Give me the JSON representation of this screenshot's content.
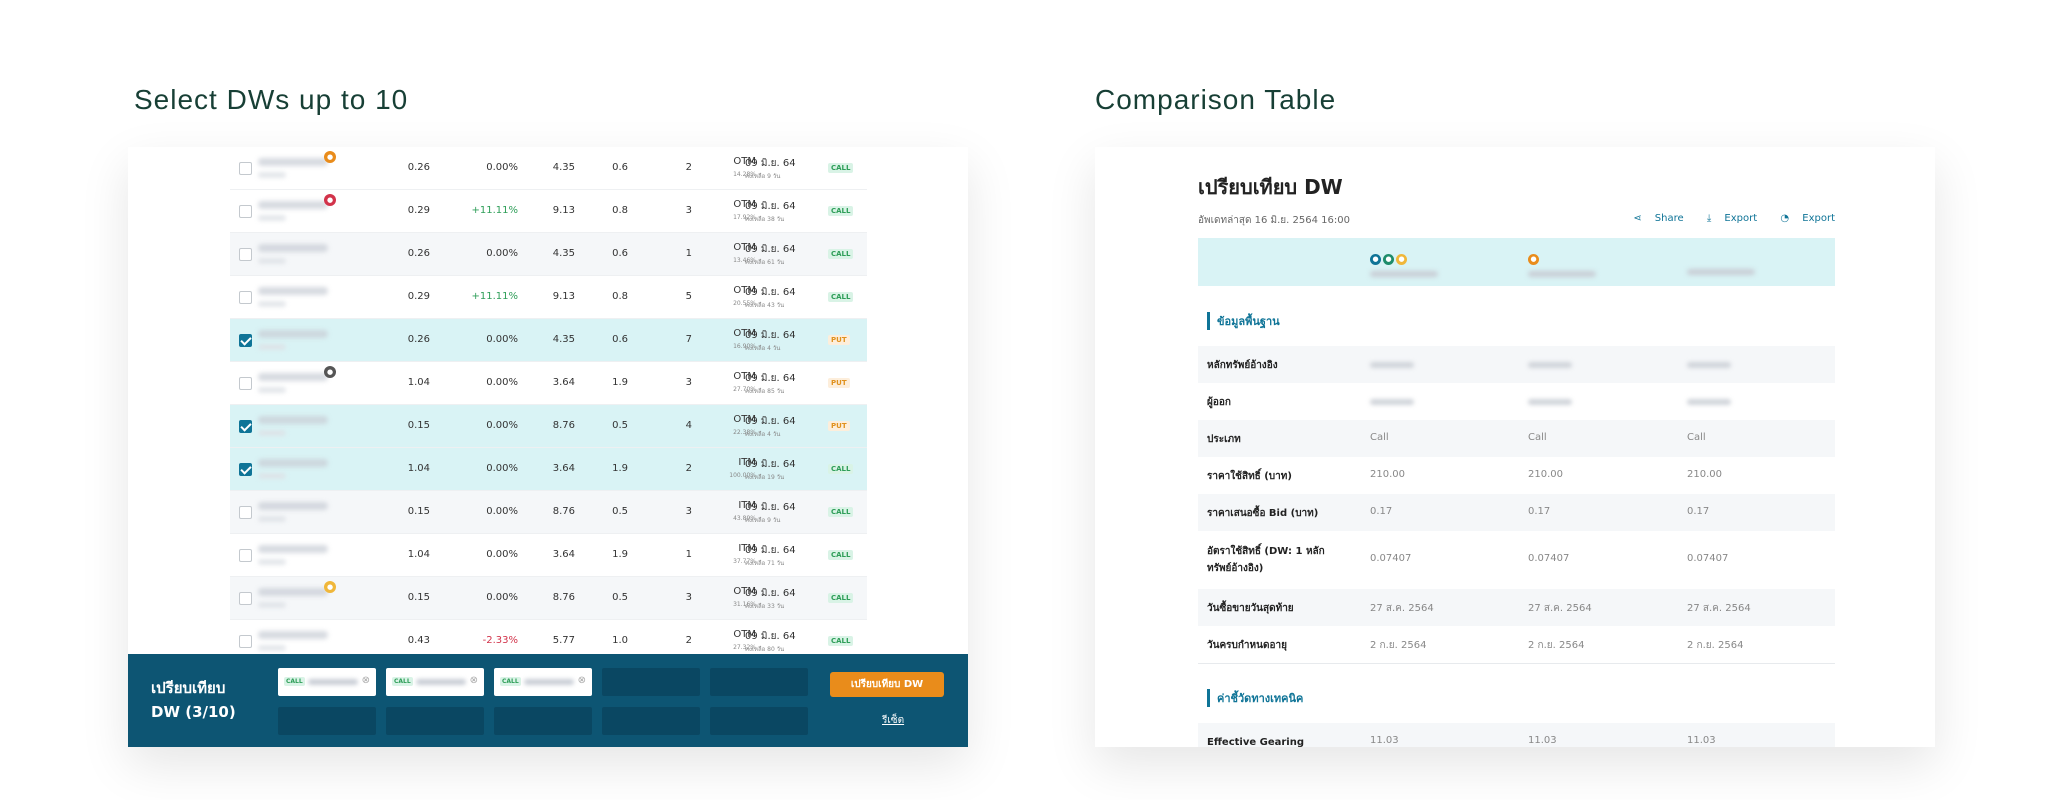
{
  "left_title": "Select DWs up to 10",
  "right_title": "Comparison Table",
  "colors": {
    "accent": "#0f7497",
    "bar": "#0d5573",
    "orange": "#e98c1b",
    "highlight": "#d9f3f5",
    "green": "#2e9e58",
    "red": "#d2334a"
  },
  "rows": [
    {
      "checked": false,
      "bg": "plain",
      "icon": "orange",
      "bid": "0.26",
      "change": "0.00%",
      "trend": "flat",
      "last": "4.35",
      "gearing": "0.6",
      "volume": "2",
      "status": "OTM",
      "pct": "14.28%",
      "date": "09 มิ.ย. 64",
      "days": "คงเหลือ 9 วัน",
      "type": "CALL"
    },
    {
      "checked": false,
      "bg": "plain",
      "icon": "pink",
      "bid": "0.29",
      "change": "+11.11%",
      "trend": "pos",
      "last": "9.13",
      "gearing": "0.8",
      "volume": "3",
      "status": "OTM",
      "pct": "17.92%",
      "date": "09 มิ.ย. 64",
      "days": "คงเหลือ 38 วัน",
      "type": "CALL"
    },
    {
      "checked": false,
      "bg": "alt",
      "icon": "",
      "bid": "0.26",
      "change": "0.00%",
      "trend": "flat",
      "last": "4.35",
      "gearing": "0.6",
      "volume": "1",
      "status": "OTM",
      "pct": "13.46%",
      "date": "09 มิ.ย. 64",
      "days": "คงเหลือ 61 วัน",
      "type": "CALL"
    },
    {
      "checked": false,
      "bg": "plain",
      "icon": "",
      "bid": "0.29",
      "change": "+11.11%",
      "trend": "pos",
      "last": "9.13",
      "gearing": "0.8",
      "volume": "5",
      "status": "OTM",
      "pct": "20.55%",
      "date": "09 มิ.ย. 64",
      "days": "คงเหลือ 43 วัน",
      "type": "CALL"
    },
    {
      "checked": true,
      "bg": "sel",
      "icon": "",
      "bid": "0.26",
      "change": "0.00%",
      "trend": "flat",
      "last": "4.35",
      "gearing": "0.6",
      "volume": "7",
      "status": "OTM",
      "pct": "16.90%",
      "date": "09 มิ.ย. 64",
      "days": "คงเหลือ 4 วัน",
      "type": "PUT"
    },
    {
      "checked": false,
      "bg": "plain",
      "icon": "grey",
      "bid": "1.04",
      "change": "0.00%",
      "trend": "flat",
      "last": "3.64",
      "gearing": "1.9",
      "volume": "3",
      "status": "OTM",
      "pct": "27.70%",
      "date": "09 มิ.ย. 64",
      "days": "คงเหลือ 85 วัน",
      "type": "PUT"
    },
    {
      "checked": true,
      "bg": "sel",
      "icon": "",
      "bid": "0.15",
      "change": "0.00%",
      "trend": "flat",
      "last": "8.76",
      "gearing": "0.5",
      "volume": "4",
      "status": "OTM",
      "pct": "22.38%",
      "date": "09 มิ.ย. 64",
      "days": "คงเหลือ 4 วัน",
      "type": "PUT"
    },
    {
      "checked": true,
      "bg": "sel",
      "icon": "",
      "bid": "1.04",
      "change": "0.00%",
      "trend": "flat",
      "last": "3.64",
      "gearing": "1.9",
      "volume": "2",
      "status": "ITM",
      "pct": "100.00%",
      "date": "09 มิ.ย. 64",
      "days": "คงเหลือ 19 วัน",
      "type": "CALL"
    },
    {
      "checked": false,
      "bg": "alt",
      "icon": "",
      "bid": "0.15",
      "change": "0.00%",
      "trend": "flat",
      "last": "8.76",
      "gearing": "0.5",
      "volume": "3",
      "status": "ITM",
      "pct": "43.89%",
      "date": "09 มิ.ย. 64",
      "days": "คงเหลือ 9 วัน",
      "type": "CALL"
    },
    {
      "checked": false,
      "bg": "plain",
      "icon": "",
      "bid": "1.04",
      "change": "0.00%",
      "trend": "flat",
      "last": "3.64",
      "gearing": "1.9",
      "volume": "1",
      "status": "ITM",
      "pct": "37.77%",
      "date": "09 มิ.ย. 64",
      "days": "คงเหลือ 71 วัน",
      "type": "CALL"
    },
    {
      "checked": false,
      "bg": "alt",
      "icon": "yellow",
      "bid": "0.15",
      "change": "0.00%",
      "trend": "flat",
      "last": "8.76",
      "gearing": "0.5",
      "volume": "3",
      "status": "OTM",
      "pct": "31.16%",
      "date": "09 มิ.ย. 64",
      "days": "คงเหลือ 33 วัน",
      "type": "CALL"
    },
    {
      "checked": false,
      "bg": "plain",
      "icon": "",
      "bid": "0.43",
      "change": "-2.33%",
      "trend": "neg",
      "last": "5.77",
      "gearing": "1.0",
      "volume": "2",
      "status": "OTM",
      "pct": "27.32%",
      "date": "09 มิ.ย. 64",
      "days": "คงเหลือ 80 วัน",
      "type": "CALL"
    }
  ],
  "compare_bar": {
    "title": "เปรียบเทียบ DW (3/10)",
    "slots": [
      {
        "filled": true,
        "tag": "CALL"
      },
      {
        "filled": true,
        "tag": "CALL"
      },
      {
        "filled": true,
        "tag": "CALL"
      },
      {
        "filled": false
      },
      {
        "filled": false
      },
      {
        "filled": false
      },
      {
        "filled": false
      },
      {
        "filled": false
      },
      {
        "filled": false
      },
      {
        "filled": false
      }
    ],
    "compare_button": "เปรียบเทียบ DW",
    "reset_link": "รีเซ็ต"
  },
  "comparison": {
    "title": "เปรียบเทียบ DW",
    "updated": "อัพเดทล่าสุด 16 มิ.ย. 2564 16:00",
    "actions": [
      "Share",
      "Export",
      "Export"
    ],
    "section_basic": "ข้อมูลพื้นฐาน",
    "section_tech": "ค่าชี้วัดทางเทคนิค",
    "rows": [
      {
        "label": "หลักทรัพย์อ้างอิง",
        "values": [
          "",
          "",
          ""
        ],
        "blurred": true
      },
      {
        "label": "ผู้ออก",
        "values": [
          "",
          "",
          ""
        ],
        "blurred": true
      },
      {
        "label": "ประเภท",
        "values": [
          "Call",
          "Call",
          "Call"
        ]
      },
      {
        "label": "ราคาใช้สิทธิ์ (บาท)",
        "values": [
          "210.00",
          "210.00",
          "210.00"
        ]
      },
      {
        "label": "ราคาเสนอซื้อ Bid (บาท)",
        "values": [
          "0.17",
          "0.17",
          "0.17"
        ]
      },
      {
        "label": "อัตราใช้สิทธิ์ (DW: 1 หลักทรัพย์อ้างอิง)",
        "values": [
          "0.07407",
          "0.07407",
          "0.07407"
        ]
      },
      {
        "label": "วันซื้อขายวันสุดท้าย",
        "values": [
          "27 ส.ค. 2564",
          "27 ส.ค. 2564",
          "27 ส.ค. 2564"
        ]
      },
      {
        "label": "วันครบกำหนดอายุ",
        "values": [
          "2 ก.ย. 2564",
          "2 ก.ย. 2564",
          "2 ก.ย. 2564"
        ]
      }
    ],
    "tech_rows": [
      {
        "label": "Effective Gearing",
        "values": [
          "11.03",
          "11.03",
          "11.03"
        ]
      }
    ]
  }
}
